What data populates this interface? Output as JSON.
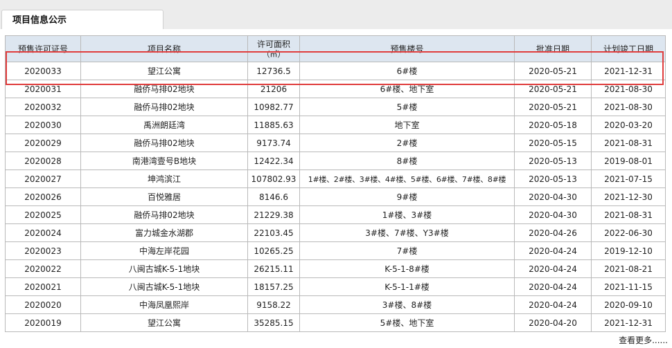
{
  "tab": {
    "label": "项目信息公示"
  },
  "table": {
    "headers": {
      "permit_no": "预售许可证号",
      "project_name": "项目名称",
      "area_label": "许可面积",
      "area_unit": "（㎡）",
      "buildings": "预售楼号",
      "approval_date": "批准日期",
      "completion_date": "计划竣工日期"
    },
    "rows": [
      [
        "2020033",
        "望江公寓",
        "12736.5",
        "6#楼",
        "2020-05-21",
        "2021-12-31"
      ],
      [
        "2020031",
        "融侨马排02地块",
        "21206",
        "6#楼、地下室",
        "2020-05-21",
        "2021-08-30"
      ],
      [
        "2020032",
        "融侨马排02地块",
        "10982.77",
        "5#楼",
        "2020-05-21",
        "2021-08-30"
      ],
      [
        "2020030",
        "禹洲朗廷湾",
        "11885.63",
        "地下室",
        "2020-05-18",
        "2020-03-20"
      ],
      [
        "2020029",
        "融侨马排02地块",
        "9173.74",
        "2#楼",
        "2020-05-15",
        "2021-08-31"
      ],
      [
        "2020028",
        "南港湾壹号B地块",
        "12422.34",
        "8#楼",
        "2020-05-13",
        "2019-08-01"
      ],
      [
        "2020027",
        "坤鸿滨江",
        "107802.93",
        "1#楼、2#楼、3#楼、4#楼、5#楼、6#楼、7#楼、8#楼",
        "2020-05-13",
        "2021-07-15"
      ],
      [
        "2020026",
        "百悦雅居",
        "8146.6",
        "9#楼",
        "2020-04-30",
        "2021-12-30"
      ],
      [
        "2020025",
        "融侨马排02地块",
        "21229.38",
        "1#楼、3#楼",
        "2020-04-30",
        "2021-08-31"
      ],
      [
        "2020024",
        "富力城金水湖郡",
        "22103.45",
        "3#楼、7#楼、Y3#楼",
        "2020-04-26",
        "2022-06-30"
      ],
      [
        "2020023",
        "中海左岸花园",
        "10265.25",
        "7#楼",
        "2020-04-24",
        "2019-12-10"
      ],
      [
        "2020022",
        "八闽古城K-5-1地块",
        "26215.11",
        "K-5-1-8#楼",
        "2020-04-24",
        "2021-08-21"
      ],
      [
        "2020021",
        "八闽古城K-5-1地块",
        "18157.25",
        "K-5-1-1#楼",
        "2020-04-24",
        "2021-11-15"
      ],
      [
        "2020020",
        "中海凤凰熙岸",
        "9158.22",
        "3#楼、8#楼",
        "2020-04-24",
        "2020-09-10"
      ],
      [
        "2020019",
        "望江公寓",
        "35285.15",
        "5#楼、地下室",
        "2020-04-20",
        "2021-12-31"
      ]
    ]
  },
  "more_link": "查看更多......",
  "colors": {
    "highlight": "#e03c3c",
    "header_bg": "#dde6f0"
  }
}
